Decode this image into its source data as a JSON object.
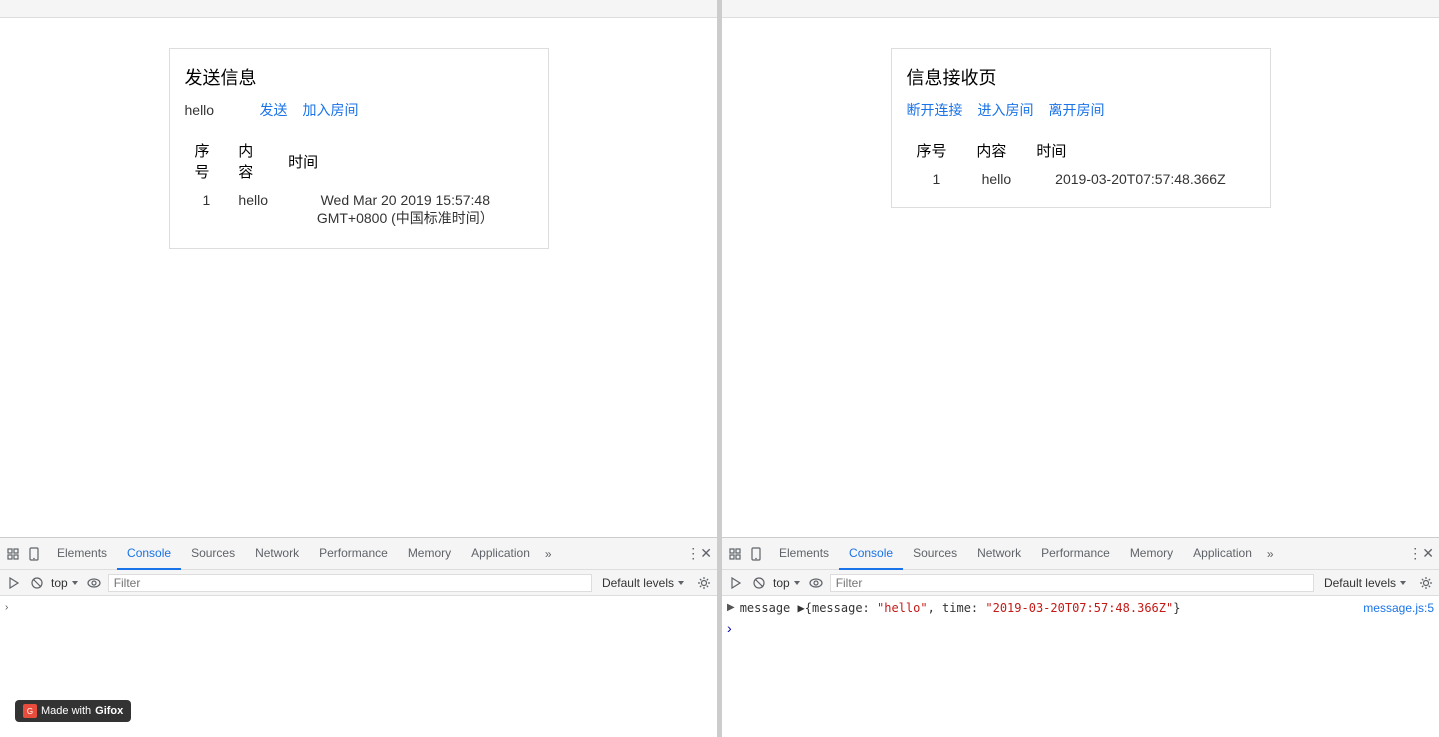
{
  "left_panel": {
    "send_title": "发送信息",
    "input_value": "hello",
    "send_btn": "发送",
    "join_btn": "加入房间",
    "table": {
      "col_seq": "序号",
      "col_content": "内容",
      "col_time": "时间",
      "rows": [
        {
          "seq": "1",
          "content": "hello",
          "time": "Wed Mar 20 2019 15:57:48 GMT+0800 (中国标准时间）"
        }
      ]
    }
  },
  "right_panel": {
    "receive_title": "信息接收页",
    "disconnect_btn": "断开连接",
    "enter_room_btn": "进入房间",
    "leave_room_btn": "离开房间",
    "table": {
      "col_seq": "序号",
      "col_content": "内容",
      "col_time": "时间",
      "rows": [
        {
          "seq": "1",
          "content": "hello",
          "time": "2019-03-20T07:57:48.366Z"
        }
      ]
    }
  },
  "left_devtools": {
    "tabs": [
      {
        "label": "Elements",
        "active": false
      },
      {
        "label": "Console",
        "active": true
      },
      {
        "label": "Sources",
        "active": false
      },
      {
        "label": "Network",
        "active": false
      },
      {
        "label": "Performance",
        "active": false
      },
      {
        "label": "Memory",
        "active": false
      },
      {
        "label": "Application",
        "active": false
      }
    ],
    "toolbar": {
      "top_select": "top",
      "filter_placeholder": "Filter",
      "default_levels": "Default levels"
    },
    "console_rows": [],
    "console_arrow": "›"
  },
  "right_devtools": {
    "tabs": [
      {
        "label": "Elements",
        "active": false
      },
      {
        "label": "Console",
        "active": true
      },
      {
        "label": "Sources",
        "active": false
      },
      {
        "label": "Network",
        "active": false
      },
      {
        "label": "Performance",
        "active": false
      },
      {
        "label": "Memory",
        "active": false
      },
      {
        "label": "Application",
        "active": false
      }
    ],
    "toolbar": {
      "top_select": "top",
      "filter_placeholder": "Filter",
      "default_levels": "Default levels"
    },
    "console_message": "message",
    "console_object": "{message: \"hello\", time: \"2019-03-20T07:57:48.366Z\"}",
    "console_link": "message.js:5",
    "console_prompt": "›"
  },
  "gifox": {
    "label": "Made with",
    "brand": "Gifox"
  }
}
